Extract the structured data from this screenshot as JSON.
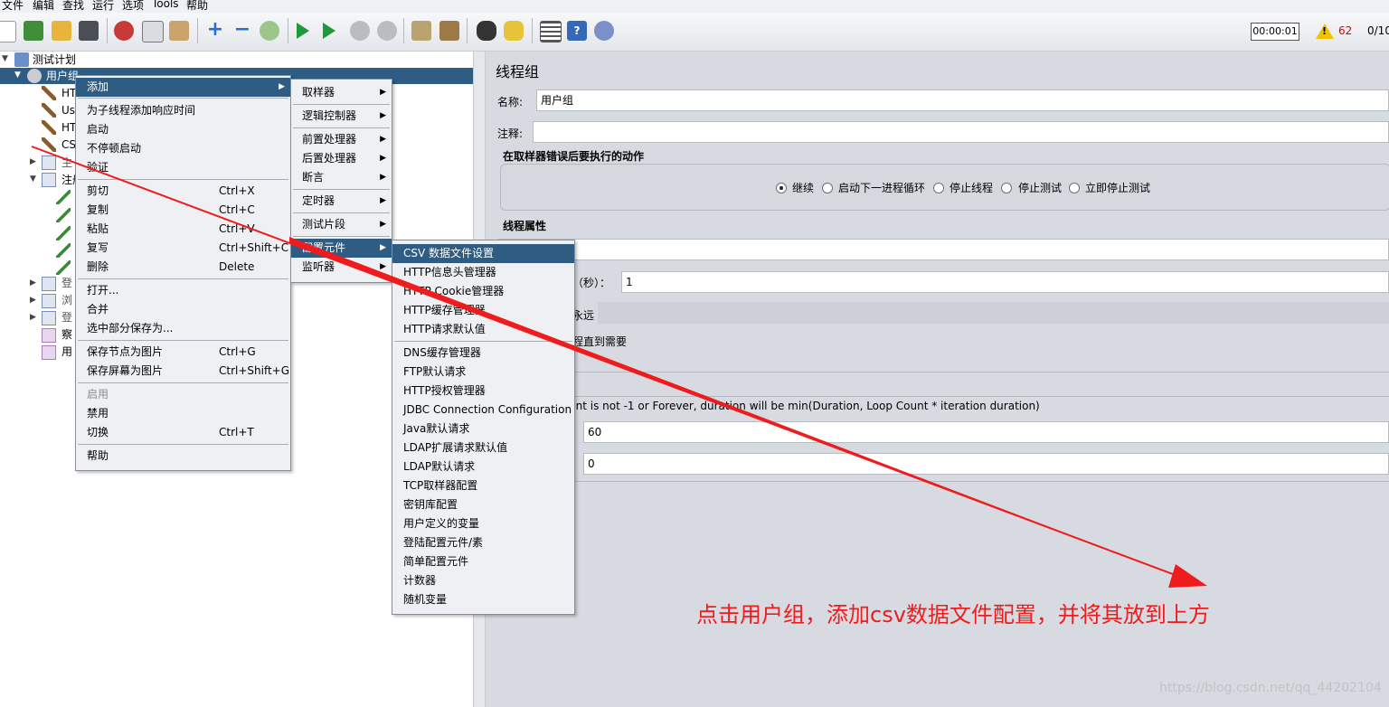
{
  "menubar": [
    "文件",
    "编辑",
    "查找",
    "运行",
    "选项",
    "Tools",
    "帮助"
  ],
  "status": {
    "timer": "00:00:01",
    "warnings": "62",
    "threads": "0/10"
  },
  "tree": {
    "root": "测试计划",
    "thread_group": "用户组",
    "children": [
      "HT",
      "Us",
      "HT",
      "CS",
      "主",
      "注册",
      "登",
      "浏",
      "登",
      "察",
      "用"
    ]
  },
  "context_menu": {
    "items": [
      {
        "label": "添加",
        "submenu": true,
        "selected": true
      },
      {
        "label": "为子线程添加响应时间"
      },
      {
        "label": "启动"
      },
      {
        "label": "不停顿启动"
      },
      {
        "label": "验证"
      },
      {
        "label": "剪切",
        "shortcut": "Ctrl+X"
      },
      {
        "label": "复制",
        "shortcut": "Ctrl+C"
      },
      {
        "label": "粘贴",
        "shortcut": "Ctrl+V"
      },
      {
        "label": "复写",
        "shortcut": "Ctrl+Shift+C"
      },
      {
        "label": "删除",
        "shortcut": "Delete"
      },
      {
        "label": "打开..."
      },
      {
        "label": "合并"
      },
      {
        "label": "选中部分保存为..."
      },
      {
        "label": "保存节点为图片",
        "shortcut": "Ctrl+G"
      },
      {
        "label": "保存屏幕为图片",
        "shortcut": "Ctrl+Shift+G"
      },
      {
        "label": "启用",
        "disabled": true
      },
      {
        "label": "禁用"
      },
      {
        "label": "切换",
        "shortcut": "Ctrl+T"
      },
      {
        "label": "帮助"
      }
    ]
  },
  "add_submenu": {
    "items": [
      {
        "label": "取样器"
      },
      {
        "label": "逻辑控制器"
      },
      {
        "label": "前置处理器"
      },
      {
        "label": "后置处理器"
      },
      {
        "label": "断言"
      },
      {
        "label": "定时器"
      },
      {
        "label": "测试片段"
      },
      {
        "label": "配置元件",
        "selected": true
      },
      {
        "label": "监听器"
      }
    ]
  },
  "config_submenu": {
    "items": [
      {
        "label": "CSV 数据文件设置",
        "selected": true
      },
      {
        "label": "HTTP信息头管理器"
      },
      {
        "label": "HTTP Cookie管理器"
      },
      {
        "label": "HTTP缓存管理器"
      },
      {
        "label": "HTTP请求默认值"
      },
      {
        "label": "DNS缓存管理器"
      },
      {
        "label": "FTP默认请求"
      },
      {
        "label": "HTTP授权管理器"
      },
      {
        "label": "JDBC Connection Configuration"
      },
      {
        "label": "Java默认请求"
      },
      {
        "label": "LDAP扩展请求默认值"
      },
      {
        "label": "LDAP默认请求"
      },
      {
        "label": "TCP取样器配置"
      },
      {
        "label": "密钥库配置"
      },
      {
        "label": "用户定义的变量"
      },
      {
        "label": "登陆配置元件/素"
      },
      {
        "label": "简单配置元件"
      },
      {
        "label": "计数器"
      },
      {
        "label": "随机变量"
      }
    ]
  },
  "panel": {
    "title": "线程组",
    "name_label": "名称:",
    "name_value": "用户组",
    "comment_label": "注释:",
    "error_action_title": "在取样器错误后要执行的动作",
    "radios": [
      "继续",
      "启动下一进程循环",
      "停止线程",
      "停止测试",
      "立即停止测试"
    ],
    "thread_props_title": "线程属性",
    "ramp_label_fragment": "（秒）：",
    "ramp_value": "1",
    "forever_fragment": "永远",
    "delay_fragment": "程直到需要",
    "duration_note": "unt is not -1 or Forever, duration will be min(Duration, Loop Count * iteration duration)",
    "duration_value": "60",
    "delay_value": "0"
  },
  "annotation": "点击用户组，添加csv数据文件配置，并将其放到上方",
  "watermark": "https://blog.csdn.net/qq_44202104",
  "colors": {
    "selection": "#2f5c83",
    "annotation": "#ee1c1c",
    "arrow": "#ee1c1c"
  }
}
